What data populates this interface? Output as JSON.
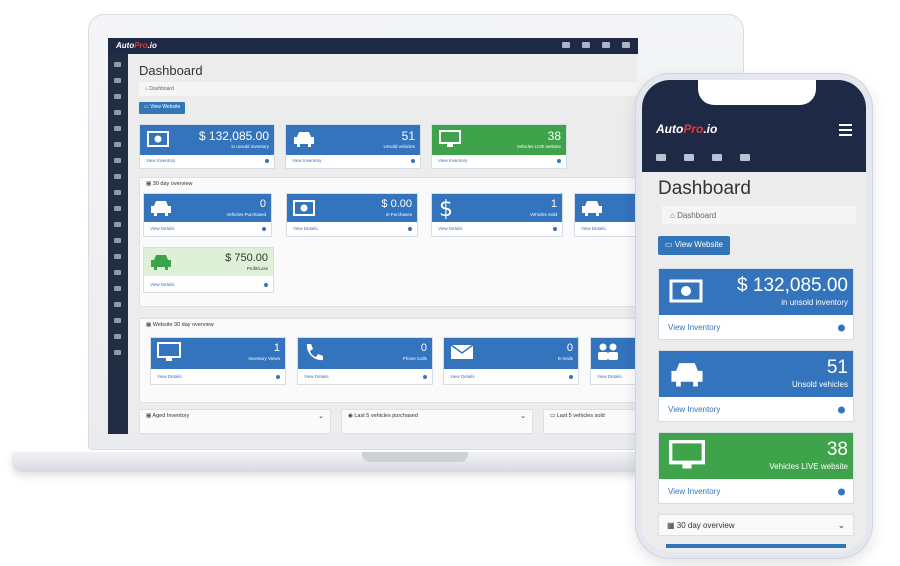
{
  "brand": {
    "name_part1": "Auto",
    "name_part2": "Pro",
    "name_part3": ".io"
  },
  "laptop": {
    "page_title": "Dashboard",
    "breadcrumb": "Dashboard",
    "view_website": "View Website",
    "stats": [
      {
        "value": "$ 132,085.00",
        "label": "in unsold inventory",
        "link": "View Inventory",
        "color": "blue"
      },
      {
        "value": "51",
        "label": "Unsold vehicles",
        "link": "View Inventory",
        "color": "blue"
      },
      {
        "value": "38",
        "label": "Vehicles LIVE website",
        "link": "View Inventory",
        "color": "green"
      }
    ],
    "overview_title": "30 day overview",
    "overview": [
      {
        "value": "0",
        "label": "Vehicles Purchased",
        "link": "View Details"
      },
      {
        "value": "$ 0.00",
        "label": "in Purchases",
        "link": "View Details"
      },
      {
        "value": "1",
        "label": "Vehicles Sold",
        "link": "View Details"
      },
      {
        "value": "",
        "label": "",
        "link": "View Details"
      },
      {
        "value": "$ 750.00",
        "label": "Profit/Loss",
        "link": "View Details"
      }
    ],
    "website_title": "Website 30 day overview",
    "website": [
      {
        "value": "1",
        "label": "Inventory Views",
        "link": "View Details"
      },
      {
        "value": "0",
        "label": "Phone Calls",
        "link": "View Details"
      },
      {
        "value": "0",
        "label": "E-mails",
        "link": "View Details"
      },
      {
        "value": "",
        "label": "",
        "link": "View Details"
      }
    ],
    "bottom_panels": [
      "Aged Inventory",
      "Last 5 vehicles purchased",
      "Last 5 vehicles sold"
    ]
  },
  "phone": {
    "page_title": "Dashboard",
    "breadcrumb": "Dashboard",
    "view_website": "View Website",
    "stats": [
      {
        "value": "$ 132,085.00",
        "label": "in unsold inventory",
        "link": "View Inventory",
        "color": "blue"
      },
      {
        "value": "51",
        "label": "Unsold vehicles",
        "link": "View Inventory",
        "color": "blue"
      },
      {
        "value": "38",
        "label": "Vehicles LIVE website",
        "link": "View Inventory",
        "color": "green"
      }
    ],
    "overview_title": "30 day overview"
  },
  "icons": [
    "money-icon",
    "car-icon",
    "monitor-icon",
    "dollar-icon",
    "phone-icon",
    "envelope-icon",
    "users-icon",
    "home-icon",
    "calendar-icon",
    "chevron-down-icon",
    "arrow-circle-icon",
    "hamburger-menu-icon",
    "comments-icon",
    "bell-icon",
    "user-icon"
  ],
  "colors": {
    "topbar": "#1e2a45",
    "primary": "#3474bd",
    "success": "#3ea34a",
    "success_light": "#dff0d8"
  }
}
